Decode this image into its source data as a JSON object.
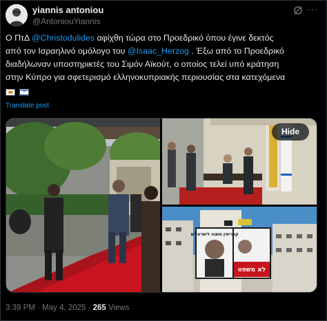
{
  "author": {
    "name": "yiannis antoniou",
    "handle": "@AntoniouYiannis"
  },
  "tweet": {
    "line1_pre": "Ο ΠτΔ ",
    "mention1": "@Christodulides",
    "line1_post": " αφίχθη τώρα στο Προεδρικό όπου έγινε δεκτός",
    "line2_pre": "από τον Ισραηλινό ομόλογο του ",
    "mention2": "@Isaac_Herzog",
    "line2_post": " . Έξω από το Προεδρικό",
    "line3": "διαδήλωναν υποστηρικτές του Σιμόν Αϊκούτ, ο οποίος τελεί υπό κράτηση",
    "line4": "στην Κύπρο για σφετερισμό ελληνοκυπριακής περιουσίας στα κατεχόμενα",
    "flags": [
      "cyprus-flag",
      "israel-flag"
    ]
  },
  "translate_label": "Translate post",
  "media": {
    "hide_label": "Hide",
    "billboard": {
      "top_text": "קפריסין משנה לישראלים",
      "bottom_text": "לא משפט"
    }
  },
  "footer": {
    "time": "3:39 PM",
    "separator": " · ",
    "date": "May 4, 2025",
    "views_count": "265",
    "views_label": " Views"
  },
  "colors": {
    "background": "#000000",
    "text": "#e7e9ea",
    "secondary": "#71767b",
    "link": "#1d9bf0",
    "red_carpet": "#c8141e"
  }
}
